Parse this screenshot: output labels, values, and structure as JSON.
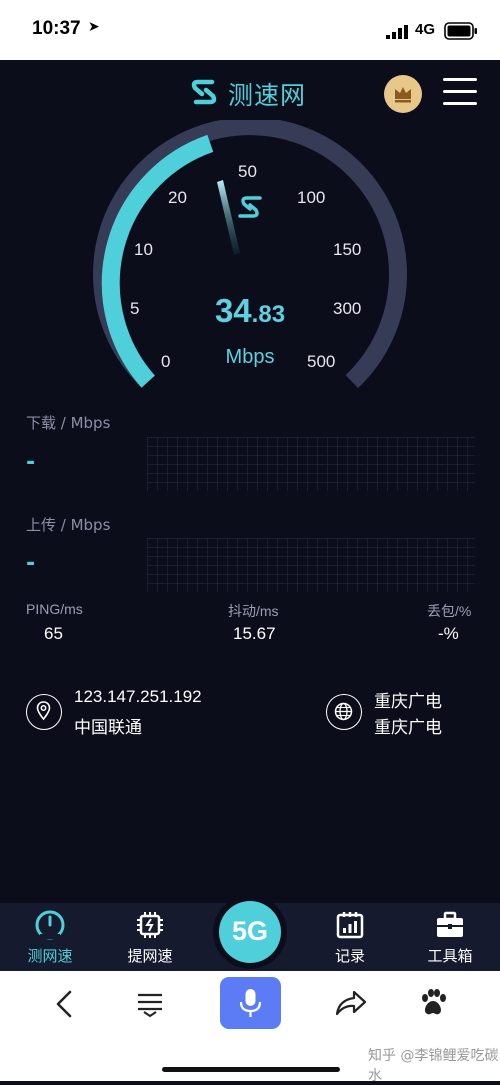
{
  "status_bar": {
    "time": "10:37",
    "network": "4G"
  },
  "header": {
    "title": "测速网"
  },
  "gauge": {
    "ticks": [
      "0",
      "5",
      "10",
      "20",
      "50",
      "100",
      "150",
      "300",
      "500"
    ],
    "speed_int": "34",
    "speed_dec": ".83",
    "unit": "Mbps",
    "colors": {
      "active": "#4ecfd9",
      "inactive": "#363b56"
    }
  },
  "download": {
    "label": "下载 / Mbps",
    "value": "-"
  },
  "upload": {
    "label": "上传 / Mbps",
    "value": "-"
  },
  "metrics": {
    "ping_label": "PING/ms",
    "ping_value": "65",
    "jitter_label": "抖动/ms",
    "jitter_value": "15.67",
    "loss_label": "丢包/%",
    "loss_value": "-%"
  },
  "client": {
    "ip": "123.147.251.192",
    "isp": "中国联通"
  },
  "server": {
    "name": "重庆广电",
    "isp": "重庆广电"
  },
  "bottom_nav": {
    "items": [
      "测网速",
      "提网速",
      "记录",
      "工具箱"
    ],
    "center": "5G"
  },
  "watermark": "知乎 @李锦鲤爱吃碳水",
  "icons": [
    "location-pin-icon",
    "globe-icon",
    "crown-icon",
    "menu-icon",
    "back-icon",
    "tabs-icon",
    "mic-icon",
    "share-icon",
    "paw-icon"
  ]
}
